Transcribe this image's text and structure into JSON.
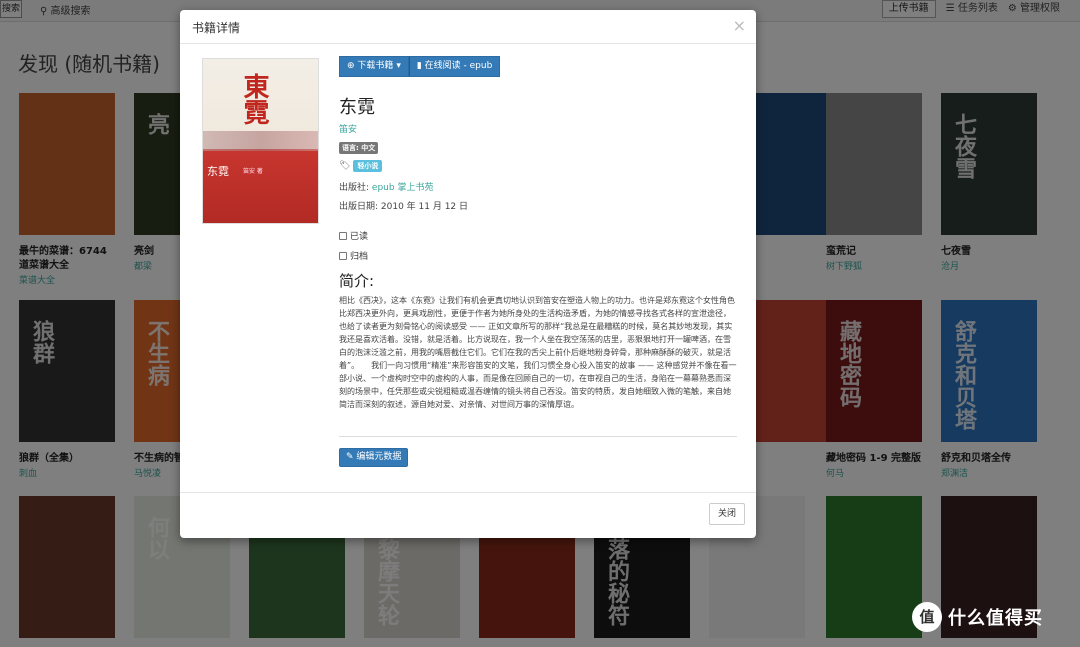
{
  "navbar": {
    "left_button": "搜索",
    "search_link": "高级搜索",
    "upload": "上传书籍",
    "tasks": "任务列表",
    "admin": "管理权限"
  },
  "page": {
    "heading": "发现 (随机书籍)"
  },
  "books": [
    {
      "title": "最牛的菜谱：6744 道菜谱大全",
      "author": "菜谱大全",
      "cover_text": "",
      "color": "#c7622d"
    },
    {
      "title": "亮剑",
      "author": "都梁",
      "cover_text": "亮",
      "color": "#2f3a22"
    },
    {
      "title": "",
      "author": "",
      "cover_text": "",
      "color": "#1e4a7a"
    },
    {
      "title": "蛮荒记",
      "author": "树下野狐",
      "cover_text": "",
      "color": "#8a8a8a"
    },
    {
      "title": "七夜雪",
      "author": "沧月",
      "cover_text": "七夜雪",
      "color": "#2e3a36"
    },
    {
      "title": "狼群（全集）",
      "author": "刺血",
      "cover_text": "狼群",
      "color": "#333333"
    },
    {
      "title": "不生病的智",
      "author": "马悦凌",
      "cover_text": "不生病",
      "color": "#e26b2a"
    },
    {
      "title": "",
      "author": "",
      "cover_text": "",
      "color": "#c44535"
    },
    {
      "title": "藏地密码 1-9 完整版",
      "author": "何马",
      "cover_text": "藏地密码",
      "color": "#7a1b1b"
    },
    {
      "title": "舒克和贝塔全传",
      "author": "郑渊洁",
      "cover_text": "舒克和贝塔",
      "color": "#2f74c0"
    },
    {
      "title": "",
      "author": "",
      "cover_text": "",
      "color": "#6a3a2a"
    },
    {
      "title": "",
      "author": "",
      "cover_text": "何以",
      "color": "#e8ece4"
    },
    {
      "title": "",
      "author": "",
      "cover_text": "",
      "color": "#3a6a3a"
    },
    {
      "title": "",
      "author": "",
      "cover_text": "巴黎摩天轮",
      "color": "#d8d4cc"
    },
    {
      "title": "",
      "author": "",
      "cover_text": "墙",
      "color": "#8a2a1a"
    },
    {
      "title": "",
      "author": "",
      "cover_text": "失落的秘符",
      "color": "#1b1b1b"
    },
    {
      "title": "",
      "author": "",
      "cover_text": "",
      "color": "#f2f2f2"
    },
    {
      "title": "",
      "author": "",
      "cover_text": "",
      "color": "#2f7a2f"
    },
    {
      "title": "",
      "author": "",
      "cover_text": "",
      "color": "#3a2020"
    }
  ],
  "modal": {
    "title": "书籍详情",
    "close_symbol": "×",
    "download_button": "下载书籍",
    "read_button": "在线阅读 - epub",
    "book_title": "东霓",
    "author": "笛安",
    "language_label": "语言: 中文",
    "tag": "轻小说",
    "publisher_label": "出版社:",
    "publisher_value": "epub 掌上书苑",
    "pubdate": "出版日期: 2010 年 11 月 12 日",
    "read_checkbox": "已读",
    "archive_checkbox": "归档",
    "summary_heading": "简介:",
    "summary": "相比《西决》，这本《东霓》让我们有机会更真切地认识到笛安在塑造人物上的功力。也许是郑东霓这个女性角色比郑西决更外向，更具戏剧性，更便于作者为她所身处的生活构造矛盾，为她的情感寻找各式各样的宣泄途径，也给了读者更为刻骨铭心的阅读感受 —— 正如文章所写的那样“我总是在最糟糕的时候，莫名其妙地发现，其实我还是喜欢活着。没错，就是活着。比方说现在，我一个人坐在我空荡荡的店里，恶狠狠地打开一罐啤酒，在雪白的泡沫泛滥之前，用我的嘴唇截住它们。它们在我的舌尖上前仆后继地粉身碎骨，那种麻酥酥的破灭，就是活着”。　　我们一向习惯用“精准”来形容笛安的文笔，我们习惯全身心投入笛安的故事 —— 这种感觉并不像在看一部小说、一个虚构时空中的虚构的人事，而是像在回顾自己的一切，在审视自己的生活，身陷在一幕幕熟悉而深刻的场景中，任凭那些或尖锐粗糙或温吞缠情的镜头将自己吞没。笛安的特质，发自她细致入微的笔触，来自她简洁而深刻的叙述，源自她对爱、对亲情、对世间万事的深情厚谊。",
    "edit_button": "编辑元数据",
    "footer_close": "关闭",
    "cover_big": "東霓",
    "cover_small": "东霓",
    "cover_author": "笛安 著"
  },
  "watermark": {
    "logo": "值",
    "text": "什么值得买"
  }
}
